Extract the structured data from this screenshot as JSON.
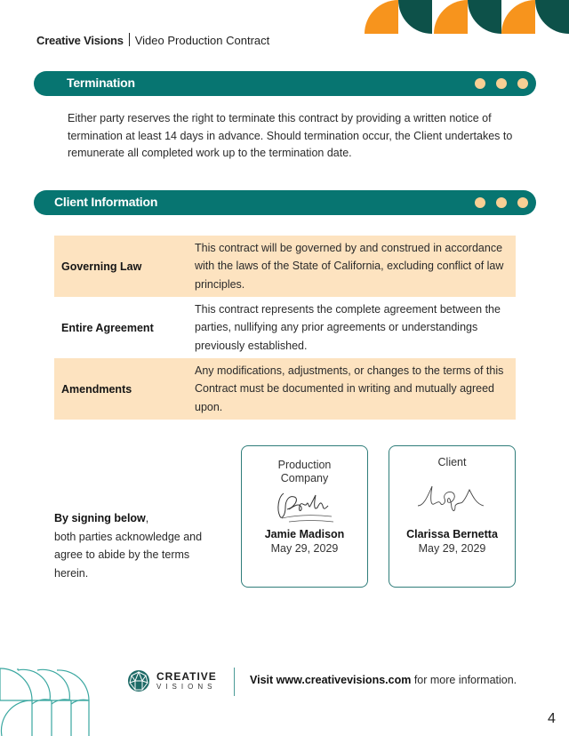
{
  "header": {
    "brand": "Creative Visions",
    "document_title": "Video Production Contract"
  },
  "colors": {
    "teal": "#077571",
    "dark_teal": "#0d5149",
    "orange": "#f7941d",
    "peach_dot": "#f8cf94",
    "table_shade": "#fde3c0"
  },
  "termination": {
    "title": "Termination",
    "body": "Either party reserves the right to terminate this contract by providing a written notice of termination at least 14 days in advance. Should termination occur, the Client undertakes to remunerate all completed work up to the termination date."
  },
  "client_information": {
    "title": "Client Information",
    "rows": [
      {
        "term": "Governing Law",
        "description": "This contract will be governed by and construed in accordance with the laws of the State of California, excluding conflict of law principles."
      },
      {
        "term": "Entire Agreement",
        "description": "This contract represents the complete agreement between the parties, nullifying any prior agreements or understandings previously established."
      },
      {
        "term": "Amendments",
        "description": "Any modifications, adjustments, or changes to the terms of this Contract must be documented in writing and mutually agreed upon."
      }
    ]
  },
  "signing": {
    "lead": "By signing below",
    "rest": "both parties acknowledge and agree to abide by the terms herein.",
    "signatories": [
      {
        "role": "Production Company",
        "name": "Jamie Madison",
        "date": "May 29, 2029"
      },
      {
        "role": "Client",
        "name": "Clarissa Bernetta",
        "date": "May 29, 2029"
      }
    ]
  },
  "footer": {
    "logo_line1": "CREATIVE",
    "logo_line2": "VISIONS",
    "visit_prefix": "Visit www.creativevisions.com",
    "visit_suffix": "for more information.",
    "page_number": "4"
  }
}
